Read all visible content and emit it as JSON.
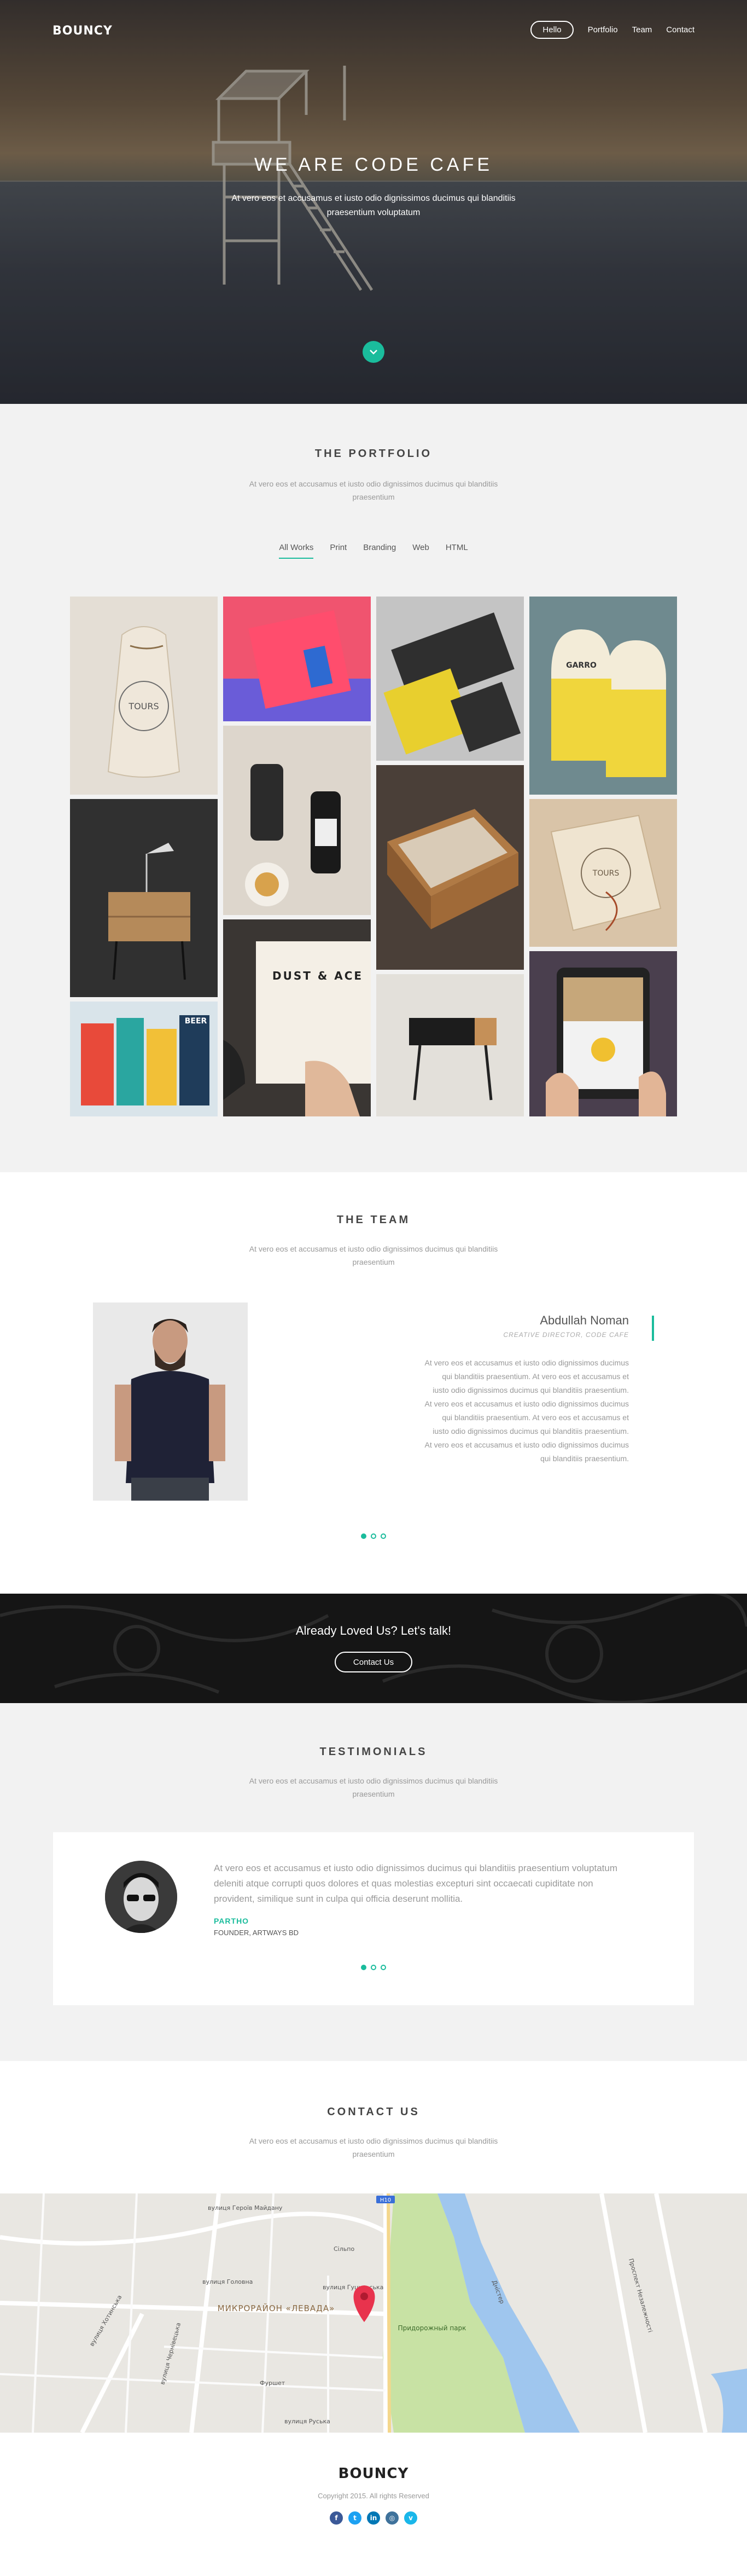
{
  "brand": {
    "name": "BOUNCY",
    "accent": "#1abc9c"
  },
  "nav": {
    "items": [
      "Hello",
      "Portfolio",
      "Team",
      "Contact"
    ],
    "active": "Hello"
  },
  "hero": {
    "title": "WE ARE CODE CAFE",
    "subtitle": "At vero eos et accusamus et iusto odio dignissimos ducimus qui blanditiis praesentium voluptatum",
    "scroll_icon": "chevron-down-icon"
  },
  "portfolio": {
    "title": "THE PORTFOLIO",
    "subtitle": "At vero eos et accusamus et iusto odio dignissimos ducimus qui blanditiis praesentium",
    "filters": [
      "All Works",
      "Print",
      "Branding",
      "Web",
      "HTML"
    ],
    "active_filter": "All Works",
    "items": [
      {
        "name": "tote-bag-work",
        "text": "TOURS"
      },
      {
        "name": "nightstand-work",
        "text": ""
      },
      {
        "name": "colorful-boxes-work",
        "text": "BEER"
      },
      {
        "name": "pink-book-work",
        "text": ""
      },
      {
        "name": "bottles-work",
        "text": ""
      },
      {
        "name": "dust-book-work",
        "text": "DUST & ACE"
      },
      {
        "name": "dark-packaging-work",
        "text": ""
      },
      {
        "name": "wood-box-work",
        "text": ""
      },
      {
        "name": "wood-stool-work",
        "text": ""
      },
      {
        "name": "yellow-slippers-work",
        "text": "GARRO"
      },
      {
        "name": "paper-wrap-work",
        "text": "TOURS"
      },
      {
        "name": "tablet-app-work",
        "text": ""
      }
    ]
  },
  "team": {
    "title": "THE TEAM",
    "subtitle": "At vero eos et accusamus et iusto odio dignissimos ducimus qui blanditiis praesentium",
    "member": {
      "name": "Abdullah Noman",
      "role": "CREATIVE DIRECTOR, CODE CAFE",
      "bio": "At vero eos et accusamus et iusto odio dignissimos ducimus qui blanditiis praesentium. At vero eos et accusamus et iusto odio dignissimos ducimus qui blanditiis praesentium. At vero eos et accusamus et iusto odio dignissimos ducimus qui blanditiis praesentium. At vero eos et accusamus et iusto odio dignissimos ducimus qui blanditiis praesentium. At vero eos et accusamus et iusto odio dignissimos ducimus qui blanditiis praesentium."
    }
  },
  "cta": {
    "title": "Already Loved Us? Let's talk!",
    "button": "Contact Us"
  },
  "testimonials": {
    "title": "TESTIMONIALS",
    "subtitle": "At vero eos et accusamus et iusto odio dignissimos ducimus qui blanditiis praesentium",
    "quote": "At vero eos et accusamus et iusto odio dignissimos ducimus qui blanditiis praesentium voluptatum deleniti atque corrupti quos dolores et quas molestias excepturi sint occaecati cupiditate non provident, similique sunt in culpa qui officia deserunt mollitia.",
    "author": "PARTHO",
    "author_role": "FOUNDER, ARTWAYS BD"
  },
  "contact": {
    "title": "CONTACT US",
    "subtitle": "At vero eos et accusamus et iusto odio dignissimos ducimus qui blanditiis praesentium",
    "map": {
      "district": "МИКРОРАЙОН «ЛЕВАДА»",
      "park": "Придорожный парк",
      "labels": [
        "Сільпо",
        "вулиця Головна",
        "вулиця Гуцульська",
        "Фуршет",
        "Дністер",
        "вулиця Чернівецька",
        "вулиця Хотинська",
        "Проспект Незалежності",
        "вулиця Героїв Майдану",
        "вулиця Руська",
        "Н10"
      ],
      "marker_icon": "map-pin-icon"
    }
  },
  "footer": {
    "brand": "BOUNCY",
    "copyright": "Copyright 2015. All rights Reserved",
    "social": [
      {
        "icon": "facebook-icon",
        "glyph": "f",
        "color": "#3b5998"
      },
      {
        "icon": "twitter-icon",
        "glyph": "t",
        "color": "#1da1f2"
      },
      {
        "icon": "linkedin-icon",
        "glyph": "in",
        "color": "#0077b5"
      },
      {
        "icon": "instagram-icon",
        "glyph": "◎",
        "color": "#3f729b"
      },
      {
        "icon": "vimeo-icon",
        "glyph": "v",
        "color": "#1ab7ea"
      }
    ]
  }
}
